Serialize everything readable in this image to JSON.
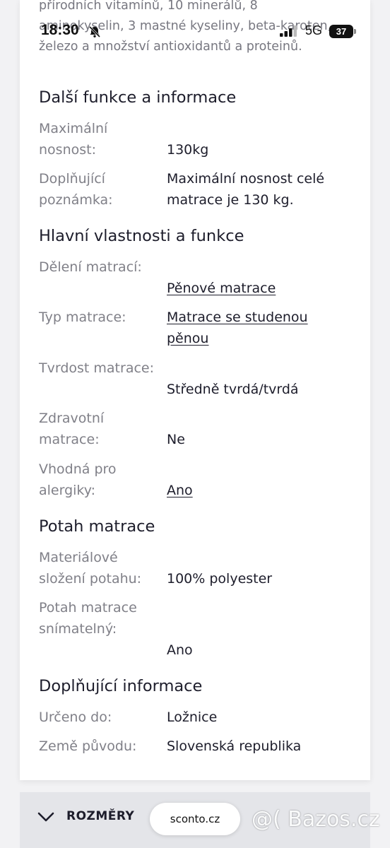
{
  "status_bar": {
    "time": "18:30",
    "network": "5G",
    "battery": "37"
  },
  "intro_text": "přírodních vitamínů, 10 minerálů, 8 aminokyselin, 3 mastné kyseliny, beta-karoten, železo a množství antioxidantů a proteinů.",
  "sections": [
    {
      "title": "Další funkce a informace",
      "rows": [
        {
          "label": "Maximální nosnost:",
          "value": "130kg"
        },
        {
          "label": "Doplňující poznámka:",
          "value": "Maximální nosnost celé matrace je 130 kg."
        }
      ]
    },
    {
      "title": "Hlavní vlastnosti a funkce",
      "rows": [
        {
          "label": "Dělení matrací:",
          "value": "Pěnové matrace"
        },
        {
          "label": "Typ matrace:",
          "value": "Matrace se studenou pěnou"
        },
        {
          "label": "Tvrdost matrace:",
          "value": "Středně tvrdá/tvrdá"
        },
        {
          "label": "Zdravotní matrace:",
          "value": "Ne"
        },
        {
          "label": "Vhodná pro alergiky:",
          "value": "Ano"
        }
      ]
    },
    {
      "title": "Potah matrace",
      "rows": [
        {
          "label": "Materiálové složení potahu:",
          "value": "100% polyester"
        },
        {
          "label": "Potah matrace snímatelný:",
          "value": "Ano"
        }
      ]
    },
    {
      "title": "Doplňující informace",
      "rows": [
        {
          "label": "Určeno do:",
          "value": "Ložnice"
        },
        {
          "label": "Země původu:",
          "value": "Slovenská republika"
        }
      ]
    }
  ],
  "dimensions_toggle": {
    "label": "ROZMĚRY",
    "icon": "chevron-down-icon"
  },
  "address_bar": {
    "url": "sconto.cz"
  },
  "watermark": "@( Bazos.cz"
}
